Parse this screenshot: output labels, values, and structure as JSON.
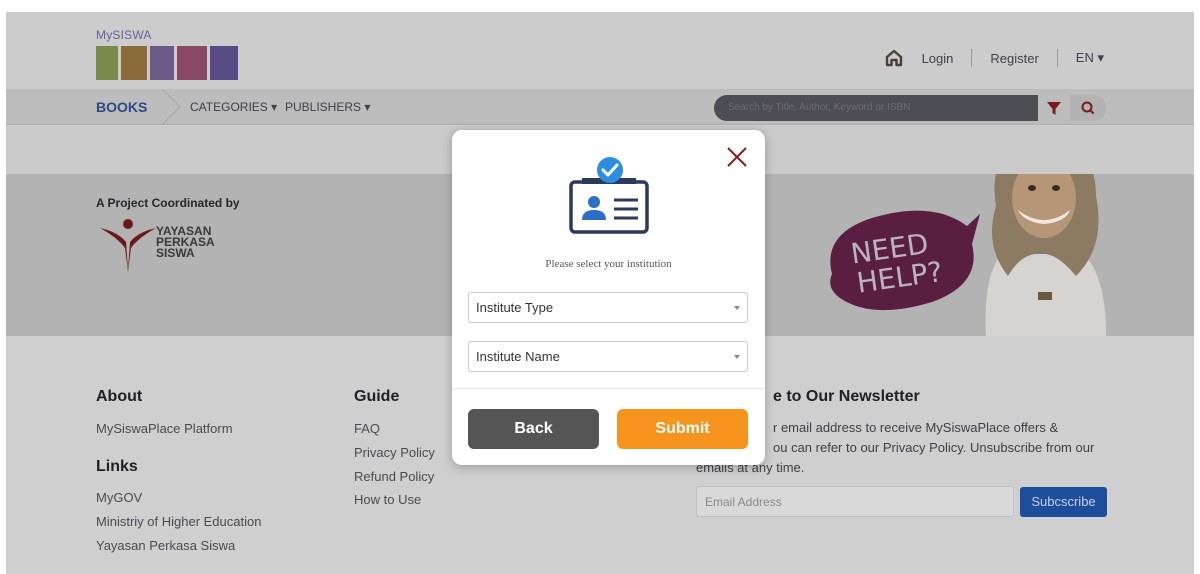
{
  "header": {
    "logo_prefix": "MySISWA",
    "logo_colors": [
      "#6ab04c",
      "#7b3f98",
      "#e94e77",
      "#f39c12",
      "#3498db",
      "#8e44ad"
    ],
    "login_label": "Login",
    "register_label": "Register",
    "language_label": "EN ▾"
  },
  "nav": {
    "books_label": "BOOKS",
    "categories_label": "CATEGORIES ▾",
    "publishers_label": "PUBLISHERS ▾",
    "search_placeholder": "Search by Title, Author, Keyword or ISBN"
  },
  "hero": {
    "project_label": "A Project Coordinated by",
    "yps_line1": "YAYASAN",
    "yps_line2": "PERKASA",
    "yps_line3": "SISWA",
    "need_help_line1": "NEED",
    "need_help_line2": "HELP?"
  },
  "footer": {
    "about_heading": "About",
    "about_link": "MySiswaPlace Platform",
    "links_heading": "Links",
    "links": [
      "MyGOV",
      "Ministriy of Higher Education",
      "Yayasan Perkasa Siswa"
    ],
    "guide_heading": "Guide",
    "guide_links": [
      "FAQ",
      "Privacy Policy",
      "Refund Policy",
      "How to Use"
    ],
    "newsletter_heading": "e to Our Newsletter",
    "newsletter_line1": "r email address to receive MySiswaPlace offers &",
    "newsletter_line2": "ou can refer to our Privacy Policy. Unsubscribe from our",
    "newsletter_line3": "emails at any time.",
    "email_placeholder": "Email Address",
    "subscribe_label": "Subcscribe"
  },
  "modal": {
    "prompt": "Please select your institution",
    "institute_type_placeholder": "Institute Type",
    "institute_name_placeholder": "Institute Name",
    "back_label": "Back",
    "submit_label": "Submit",
    "accent_color": "#f7941d",
    "icon_color": "#2d6fc4"
  }
}
